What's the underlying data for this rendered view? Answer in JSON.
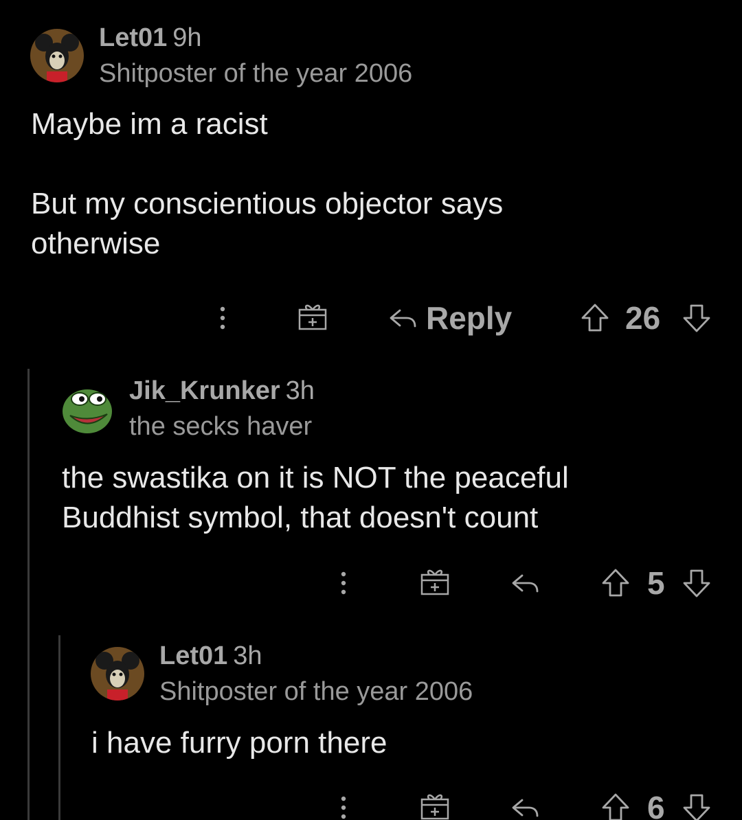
{
  "comments": [
    {
      "username": "Let01",
      "time": "9h",
      "flair": "Shitposter of the year 2006",
      "body": "Maybe im a racist\n\nBut my conscientious objector says\notherwise",
      "reply_label": "Reply",
      "score": "26",
      "avatar": "mickey-avatar"
    },
    {
      "username": "Jik_Krunker",
      "time": "3h",
      "flair": "the secks haver",
      "body": "the swastika on it is NOT the peaceful\nBuddhist symbol, that doesn't count",
      "reply_label": "",
      "score": "5",
      "avatar": "frog-avatar"
    },
    {
      "username": "Let01",
      "time": "3h",
      "flair": "Shitposter of the year 2006",
      "body": "i have furry porn there",
      "reply_label": "",
      "score": "6",
      "avatar": "mickey-avatar"
    }
  ],
  "colors": {
    "background": "#000000",
    "text": "#e8e8e8",
    "muted": "#a8a8a8",
    "thread_line": "#3a3a3a"
  }
}
